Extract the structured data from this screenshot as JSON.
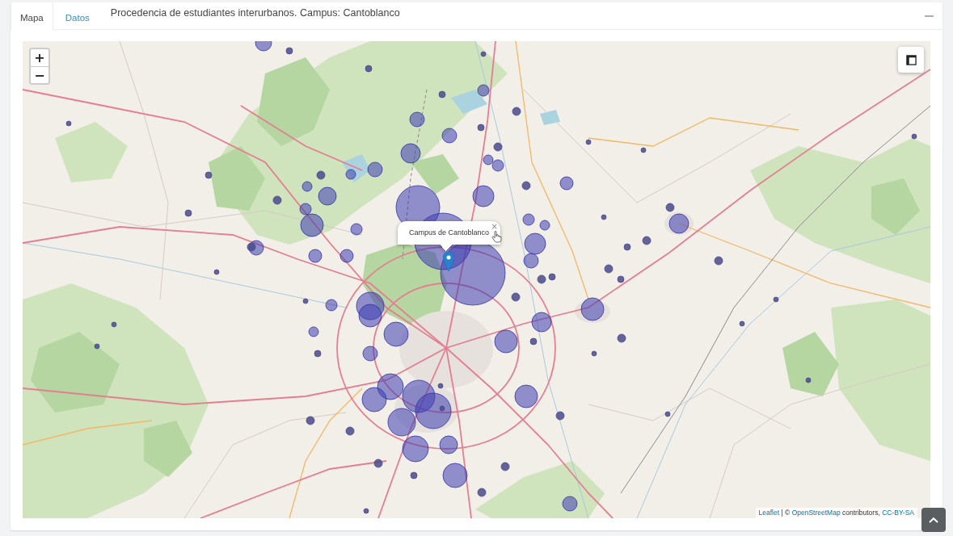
{
  "tabs": [
    {
      "label": "Mapa",
      "selected": true
    },
    {
      "label": "Datos",
      "selected": false
    }
  ],
  "title": "Procedencia de estudiantes interurbanos. Campus: Cantoblanco",
  "map": {
    "zoom_in": "+",
    "zoom_out": "−",
    "popup": {
      "text": "Campus de Cantoblanco",
      "close": "×"
    },
    "attribution": [
      {
        "kind": "link",
        "text": "Leaflet"
      },
      {
        "kind": "text",
        "text": " | © "
      },
      {
        "kind": "link",
        "text": "OpenStreetMap"
      },
      {
        "kind": "text",
        "text": " contributors, "
      },
      {
        "kind": "link",
        "text": "CC-BY-SA"
      }
    ]
  }
}
